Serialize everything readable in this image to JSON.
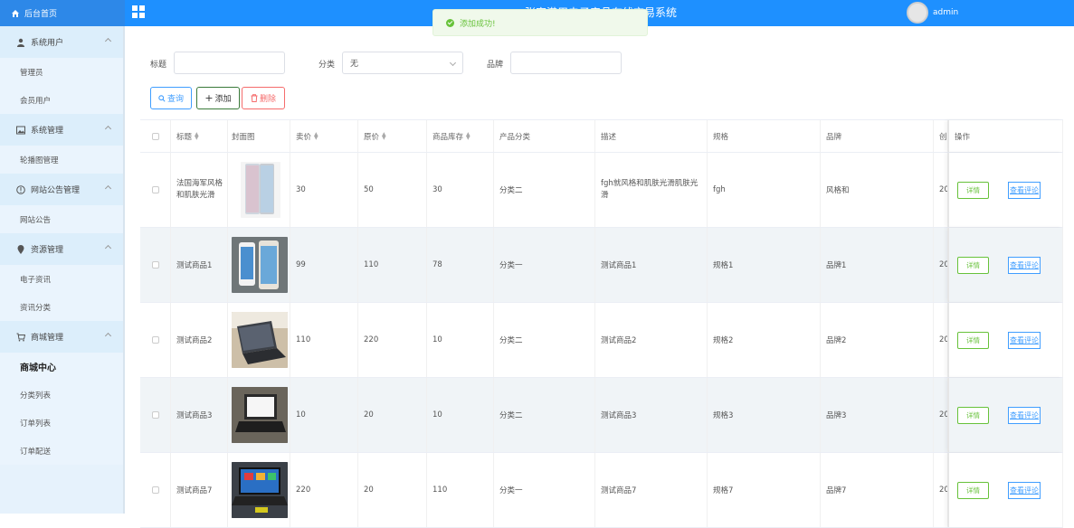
{
  "app": {
    "title": "张家港用电子产品在线交易系统",
    "home_label": "后台首页",
    "username": "admin"
  },
  "toast": {
    "message": "添加成功!"
  },
  "sidebar": {
    "groups": [
      {
        "label": "系统用户",
        "icon": "user-icon",
        "items": [
          "管理员",
          "会员用户"
        ]
      },
      {
        "label": "系统管理",
        "icon": "image-icon",
        "items": [
          "轮播图管理"
        ]
      },
      {
        "label": "网站公告管理",
        "icon": "info-icon",
        "items": [
          "网站公告"
        ]
      },
      {
        "label": "资源管理",
        "icon": "location-icon",
        "items": [
          "电子资讯",
          "资讯分类"
        ]
      },
      {
        "label": "商城管理",
        "icon": "cart-icon",
        "items": [
          "商城中心",
          "分类列表",
          "订单列表",
          "订单配送"
        ]
      }
    ]
  },
  "filters": {
    "title_label": "标题",
    "title_value": "",
    "category_label": "分类",
    "category_value": "无",
    "brand_label": "品牌",
    "brand_value": ""
  },
  "buttons": {
    "query": "查询",
    "add": "添加",
    "delete": "删除"
  },
  "table": {
    "headers": {
      "title": "标题",
      "image": "封面图",
      "price": "卖价",
      "original_price": "原价",
      "stock": "商品库存",
      "category": "产品分类",
      "description": "描述",
      "spec": "规格",
      "brand": "品牌",
      "created": "创",
      "actions": "操作"
    },
    "detail_label": "详情",
    "review_label": "查看评论",
    "rows": [
      {
        "title": "法国海军风格和肌肤光滑",
        "price": "30",
        "original_price": "50",
        "stock": "30",
        "category": "分类二",
        "description": "fgh就风格和肌肤光滑肌肤光滑",
        "spec": "fgh",
        "brand": "风格和",
        "created": "20",
        "image": "phone-white"
      },
      {
        "title": "测试商品1",
        "price": "99",
        "original_price": "110",
        "stock": "78",
        "category": "分类一",
        "description": "测试商品1",
        "spec": "规格1",
        "brand": "品牌1",
        "created": "20",
        "image": "phone-pair"
      },
      {
        "title": "测试商品2",
        "price": "110",
        "original_price": "220",
        "stock": "10",
        "category": "分类二",
        "description": "测试商品2",
        "spec": "规格2",
        "brand": "品牌2",
        "created": "20",
        "image": "laptop-desk"
      },
      {
        "title": "测试商品3",
        "price": "10",
        "original_price": "20",
        "stock": "10",
        "category": "分类二",
        "description": "测试商品3",
        "spec": "规格3",
        "brand": "品牌3",
        "created": "20",
        "image": "laptop-white-screen"
      },
      {
        "title": "测试商品7",
        "price": "220",
        "original_price": "20",
        "stock": "110",
        "category": "分类一",
        "description": "测试商品7",
        "spec": "规格7",
        "brand": "品牌7",
        "created": "20",
        "image": "laptop-blue-screen"
      }
    ]
  }
}
